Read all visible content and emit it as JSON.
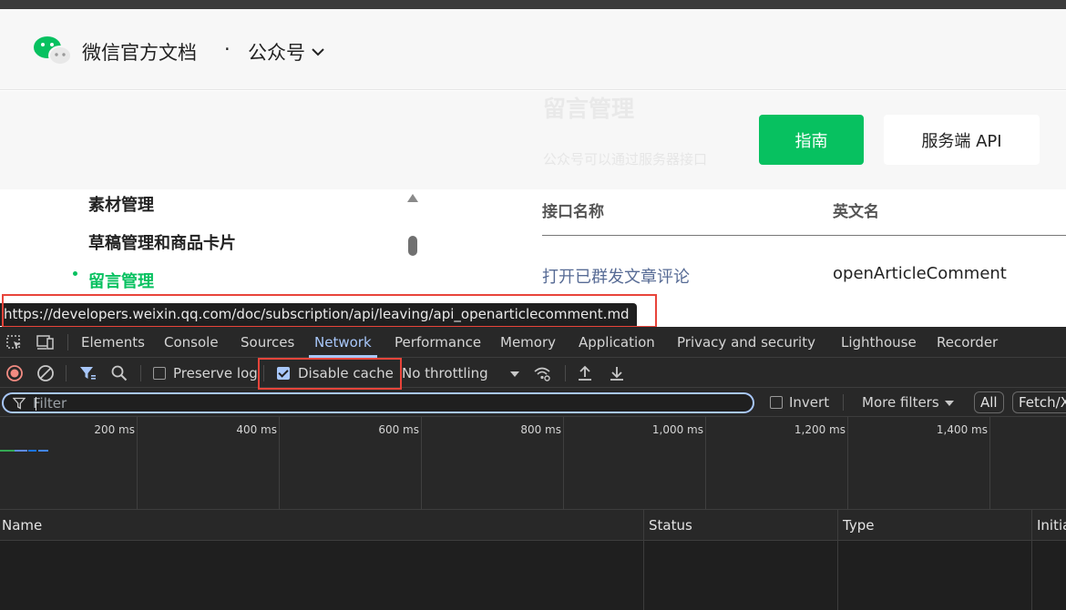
{
  "site": {
    "brand": "微信官方文档",
    "separator": "·",
    "section": "公众号"
  },
  "hero": {
    "ghost_title": "留言管理",
    "ghost_desc": "公众号可以通过服务器接口",
    "guide_button": "指南",
    "api_button": "服务端 API"
  },
  "sidebar": {
    "items": [
      {
        "label": "素材管理"
      },
      {
        "label": "草稿管理和商品卡片"
      },
      {
        "label": "留言管理",
        "active": true
      }
    ]
  },
  "api_table": {
    "headers": [
      "接口名称",
      "英文名"
    ],
    "rows": [
      {
        "name": "打开已群发文章评论",
        "en": "openArticleComment"
      }
    ]
  },
  "status_url": "https://developers.weixin.qq.com/doc/subscription/api/leaving/api_openarticlecomment.md",
  "devtools": {
    "tabs": [
      {
        "label": "Elements"
      },
      {
        "label": "Console"
      },
      {
        "label": "Sources"
      },
      {
        "label": "Network",
        "active": true
      },
      {
        "label": "Performance"
      },
      {
        "label": "Memory"
      },
      {
        "label": "Application"
      },
      {
        "label": "Privacy and security"
      },
      {
        "label": "Lighthouse"
      },
      {
        "label": "Recorder"
      }
    ],
    "toolbar": {
      "preserve_log": {
        "label": "Preserve log",
        "checked": false
      },
      "disable_cache": {
        "label": "Disable cache",
        "checked": true
      },
      "throttling": "No throttling"
    },
    "filter": {
      "placeholder": "Filter",
      "value": "",
      "invert_label": "Invert",
      "more_filters_label": "More filters",
      "type_chips": [
        "All",
        "Fetch/X"
      ]
    },
    "timeline": {
      "ticks": [
        "200 ms",
        "400 ms",
        "600 ms",
        "800 ms",
        "1,000 ms",
        "1,200 ms",
        "1,400 ms"
      ]
    },
    "columns": [
      "Name",
      "Status",
      "Type",
      "Initia"
    ]
  },
  "colors": {
    "wechat_green": "#07c160",
    "link_blue": "#576b95",
    "devtools_bg": "#282828",
    "devtools_accent": "#a8c7fa",
    "highlight_red": "#e8443a"
  }
}
